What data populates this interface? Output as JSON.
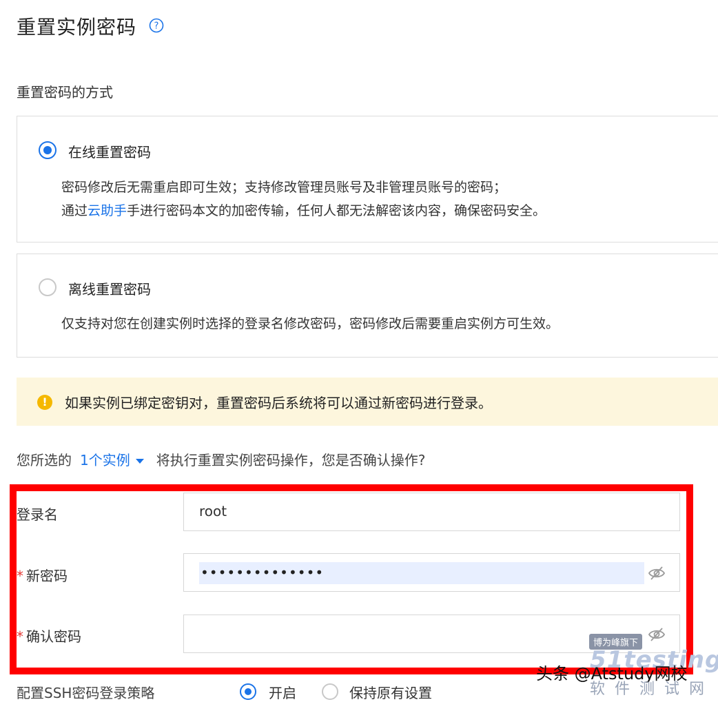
{
  "dialog": {
    "title": "重置实例密码",
    "section_label": "重置密码的方式"
  },
  "options": {
    "online": {
      "title": "在线重置密码",
      "desc_line1": "密码修改后无需重启即可生效；支持修改管理员账号及非管理员账号的密码；",
      "desc_line2_prefix": "通过",
      "desc_line2_link": "云助手",
      "desc_line2_suffix": "手进行密码本文的加密传输，任何人都无法解密该内容，确保密码安全。",
      "checked": true
    },
    "offline": {
      "title": "离线重置密码",
      "desc": "仅支持对您在创建实例时选择的登录名修改密码，密码修改后需要重启实例方可生效。",
      "checked": false
    }
  },
  "alert": {
    "icon": "!",
    "text": "如果实例已绑定密钥对，重置密码后系统将可以通过新密码进行登录。"
  },
  "confirm": {
    "prefix": "您所选的",
    "instance_count": "1个实例",
    "suffix": "将执行重置实例密码操作，您是否确认操作?"
  },
  "form": {
    "login_label": "登录名",
    "login_value": "root",
    "required_mark": "*",
    "new_password_label": "新密码",
    "new_password_value": "••••••••••••••",
    "confirm_password_label": "确认密码",
    "confirm_password_value": ""
  },
  "ssh": {
    "label": "配置SSH密码登录策略",
    "option_on": "开启",
    "option_keep": "保持原有设置"
  },
  "overlay": {
    "credit": "头条 @Atstudy网校",
    "badge": "博为峰旗下",
    "brand": "51testing",
    "brand_sub": "软件测试网"
  },
  "colors": {
    "accent": "#1a73e8",
    "highlight": "#ff0000",
    "alert_bg": "#fdf6dd",
    "warn": "#f5b800"
  }
}
